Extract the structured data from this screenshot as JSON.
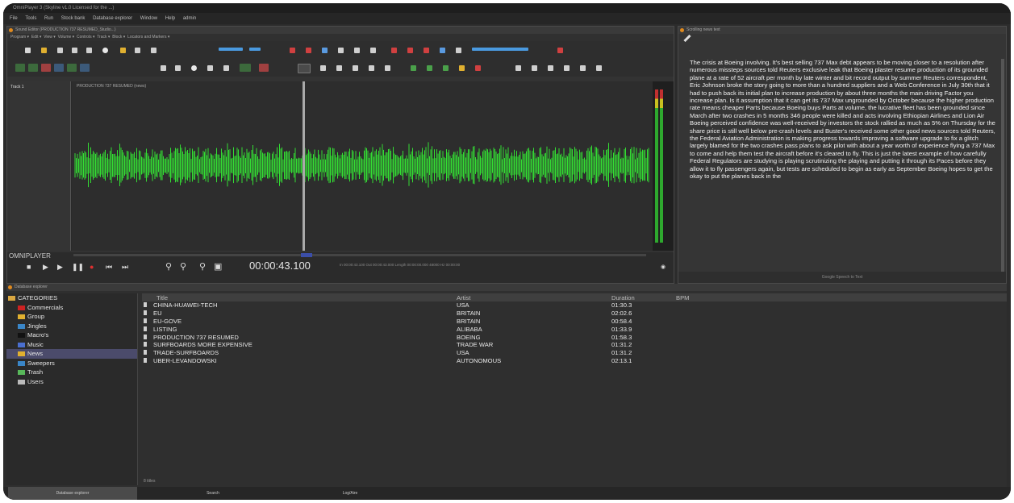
{
  "window": {
    "title": "OmniPlayer 3 (Skyline v1.0 Licensed for the ...)",
    "menu": [
      "File",
      "Tools",
      "Run",
      "Stock bank",
      "Database explorer",
      "Window",
      "Help",
      "admin"
    ]
  },
  "editor": {
    "title": "Sound Editor (PRODUCTION 737 RESUMED_Studio...)",
    "menu": [
      "Program ▾",
      "Edit ▾",
      "View ▾",
      "Volume ▾",
      "Controls ▾",
      "Track ▾",
      "Block ▾",
      "Locators and Markers ▾"
    ],
    "track_label": "Track 1",
    "clip_title": "PRODUCTION 737 RESUMED (news)",
    "player_label": "OMNIPLAYER",
    "time": "00:00:43.100",
    "info_fields": "In 00:00:43.100 Out 00:00:43.000 Length 00:00:00.000 48000 Hz 00:00:00",
    "colors": {
      "wave": "#33dd33",
      "accent": "#e08a1e"
    }
  },
  "notes": {
    "title": "Scrolling news text",
    "text": "The crisis at Boeing involving. It's best selling 737 Max debt appears to be moving closer to a resolution after numerous missteps sources told Reuters exclusive leak that Boeing plaster resume production of its grounded plane at a rate of 52 aircraft per month by late winter and bit record output by summer Reuters correspondent, Eric Johnson broke the story going to more than a hundred suppliers and a Web Conference in July 30th that it had to push back its initial plan to increase production by about three months the main driving Factor you increase plan. Is it assumption that it can get its 737 Max ungrounded by October because the higher production rate means cheaper Parts because Boeing buys Parts at volume, the lucrative fleet has been grounded since March after two crashes in 5 months 346 people were killed and acts involving Ethiopian Airlines and Lion Air Boeing perceived confidence was well-received by investors the stock rallied as much as 5% on Thursday for the share price is still well below pre-crash levels and Buster's received some other good news sources told Reuters, the Federal Aviation Administration is making progress towards improving a software upgrade to fix a glitch largely blamed for the two crashes pass plans to ask pilot with about a year worth of experience flying a 737 Max to come and help them test the aircraft before it's cleared to fly. This is just the latest example of how carefully Federal Regulators are studying is playing scrutinizing the playing and putting it through its Paces before they allow it to fly passengers again, but tests are scheduled to begin as early as September Boeing hopes to get the okay to put the planes back in the",
    "footer": "Google Speech to Text"
  },
  "browser": {
    "title": "Database explorer",
    "tree": [
      {
        "label": "CATEGORIES",
        "color": "#d9a741",
        "level": 0,
        "selected": false
      },
      {
        "label": "Commercials",
        "color": "#cc2222",
        "level": 1,
        "selected": false
      },
      {
        "label": "Group",
        "color": "#e0b030",
        "level": 1,
        "selected": false
      },
      {
        "label": "Jingles",
        "color": "#3a86c8",
        "level": 1,
        "selected": false
      },
      {
        "label": "Macro's",
        "color": "#111111",
        "level": 1,
        "selected": false
      },
      {
        "label": "Music",
        "color": "#4a6fd0",
        "level": 1,
        "selected": false
      },
      {
        "label": "News",
        "color": "#e0b030",
        "level": 1,
        "selected": true
      },
      {
        "label": "Sweepers",
        "color": "#3a86c8",
        "level": 1,
        "selected": false
      },
      {
        "label": "Trash",
        "color": "#58b85a",
        "level": 1,
        "selected": false
      },
      {
        "label": "Users",
        "color": "#bbbbbb",
        "level": 1,
        "selected": false
      }
    ],
    "columns": [
      "Title",
      "Artist",
      "Duration",
      "BPM"
    ],
    "rows": [
      [
        "CHINA-HUAWEI-TECH",
        "USA",
        "01:30.3",
        ""
      ],
      [
        "EU",
        "BRITAIN",
        "02:02.6",
        ""
      ],
      [
        "EU-GOVE",
        "BRITAIN",
        "00:58.4",
        ""
      ],
      [
        "LISTING",
        "ALIBABA",
        "01:33.9",
        ""
      ],
      [
        "PRODUCTION 737 RESUMED",
        "BOEING",
        "01:58.3",
        ""
      ],
      [
        "SURFBOARDS MORE EXPENSIVE",
        "TRADE WAR",
        "01:31.2",
        ""
      ],
      [
        "TRADE-SURFBOARDS",
        "USA",
        "01:31.2",
        ""
      ],
      [
        "UBER-LEVANDOWSKI",
        "AUTONOMOUS",
        "02:13.1",
        ""
      ]
    ],
    "count_label": "8 titles"
  },
  "bottom_tabs": [
    "Database explorer",
    "Search",
    "Log/Aire"
  ]
}
